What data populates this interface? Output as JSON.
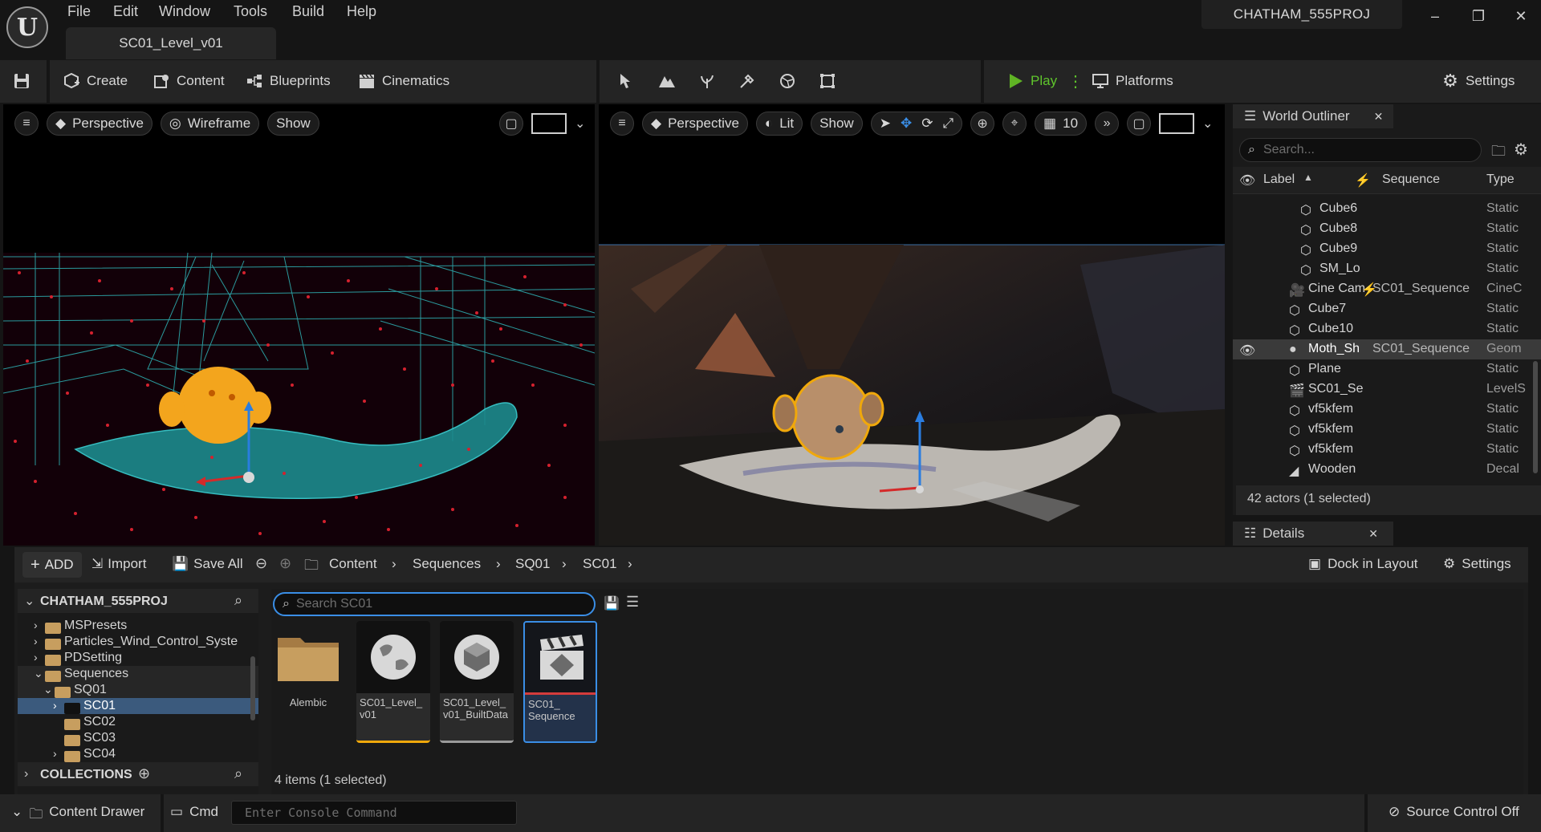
{
  "app": {
    "logo": "U",
    "project_name": "CHATHAM_555PROJ",
    "level_tab": "SC01_Level_v01"
  },
  "menu": [
    "File",
    "Edit",
    "Window",
    "Tools",
    "Build",
    "Help"
  ],
  "window_controls": {
    "minimize": "–",
    "restore": "❐",
    "close": "✕"
  },
  "toolbar": {
    "create": "Create",
    "content": "Content",
    "blueprints": "Blueprints",
    "cinematics": "Cinematics",
    "play": "Play",
    "platforms": "Platforms",
    "settings": "Settings",
    "mode_icons": [
      "select-mode-icon",
      "landscape-icon",
      "foliage-icon",
      "mesh-paint-icon",
      "fracture-icon",
      "modeling-icon"
    ]
  },
  "viewport_left": {
    "view": "Perspective",
    "mode": "Wireframe",
    "show": "Show"
  },
  "viewport_right": {
    "view": "Perspective",
    "mode": "Lit",
    "show": "Show",
    "grid_snap": "10"
  },
  "outliner": {
    "title": "World Outliner",
    "search_placeholder": "Search...",
    "columns": {
      "label": "Label",
      "sequence": "Sequence",
      "type": "Type"
    },
    "rows": [
      {
        "label": "Cube6",
        "seq": "",
        "type": "Static",
        "indent": 2,
        "icon": "static-mesh-icon"
      },
      {
        "label": "Cube8",
        "seq": "",
        "type": "Static",
        "indent": 2,
        "icon": "static-mesh-icon"
      },
      {
        "label": "Cube9",
        "seq": "",
        "type": "Static",
        "indent": 2,
        "icon": "static-mesh-icon"
      },
      {
        "label": "SM_Lo",
        "seq": "",
        "type": "Static",
        "indent": 2,
        "icon": "static-mesh-icon"
      },
      {
        "label": "Cine Cam",
        "seq": "SC01_Sequence",
        "type": "CineC",
        "indent": 1,
        "icon": "cine-camera-icon"
      },
      {
        "label": "Cube7",
        "seq": "",
        "type": "Static",
        "indent": 1,
        "icon": "static-mesh-icon"
      },
      {
        "label": "Cube10",
        "seq": "",
        "type": "Static",
        "indent": 1,
        "icon": "static-mesh-icon"
      },
      {
        "label": "Moth_Sh",
        "seq": "SC01_Sequence",
        "type": "Geom",
        "indent": 1,
        "icon": "geometry-cache-icon",
        "selected": true
      },
      {
        "label": "Plane",
        "seq": "",
        "type": "Static",
        "indent": 1,
        "icon": "static-mesh-icon"
      },
      {
        "label": "SC01_Se",
        "seq": "",
        "type": "LevelS",
        "indent": 1,
        "icon": "level-sequence-icon"
      },
      {
        "label": "vf5kfem",
        "seq": "",
        "type": "Static",
        "indent": 1,
        "icon": "static-mesh-icon"
      },
      {
        "label": "vf5kfem",
        "seq": "",
        "type": "Static",
        "indent": 1,
        "icon": "static-mesh-icon"
      },
      {
        "label": "vf5kfem",
        "seq": "",
        "type": "Static",
        "indent": 1,
        "icon": "static-mesh-icon"
      },
      {
        "label": "Wooden",
        "seq": "",
        "type": "Decal",
        "indent": 1,
        "icon": "decal-icon"
      }
    ],
    "footer": "42 actors (1 selected)",
    "details_title": "Details"
  },
  "content_browser": {
    "add": "ADD",
    "import": "Import",
    "save_all": "Save All",
    "breadcrumbs": [
      "Content",
      "Sequences",
      "SQ01",
      "SC01"
    ],
    "dock_in_layout": "Dock in Layout",
    "settings": "Settings",
    "project_root": "CHATHAM_555PROJ",
    "search_placeholder": "Search SC01",
    "tree": [
      {
        "label": "MSPresets",
        "indent": 0,
        "expand": ">"
      },
      {
        "label": "Particles_Wind_Control_Syste",
        "indent": 0,
        "expand": ">"
      },
      {
        "label": "PDSetting",
        "indent": 0,
        "expand": ">"
      },
      {
        "label": "Sequences",
        "indent": 0,
        "expand": "v",
        "open": true
      },
      {
        "label": "SQ01",
        "indent": 1,
        "expand": "v",
        "open": true
      },
      {
        "label": "SC01",
        "indent": 2,
        "expand": ">",
        "selected": true
      },
      {
        "label": "SC02",
        "indent": 2,
        "expand": ""
      },
      {
        "label": "SC03",
        "indent": 2,
        "expand": ""
      },
      {
        "label": "SC04",
        "indent": 2,
        "expand": ">"
      }
    ],
    "collections": "COLLECTIONS",
    "assets": [
      {
        "name": "Alembic",
        "kind": "folder"
      },
      {
        "name": "SC01_Level_ v01",
        "kind": "level"
      },
      {
        "name": "SC01_Level_ v01_BuiltData",
        "kind": "builtdata"
      },
      {
        "name": "SC01_ Sequence",
        "kind": "sequence",
        "selected": true
      }
    ],
    "item_count": "4 items (1 selected)"
  },
  "statusbar": {
    "content_drawer": "Content Drawer",
    "cmd": "Cmd",
    "console_placeholder": "Enter Console Command",
    "source_control": "Source Control Off"
  }
}
